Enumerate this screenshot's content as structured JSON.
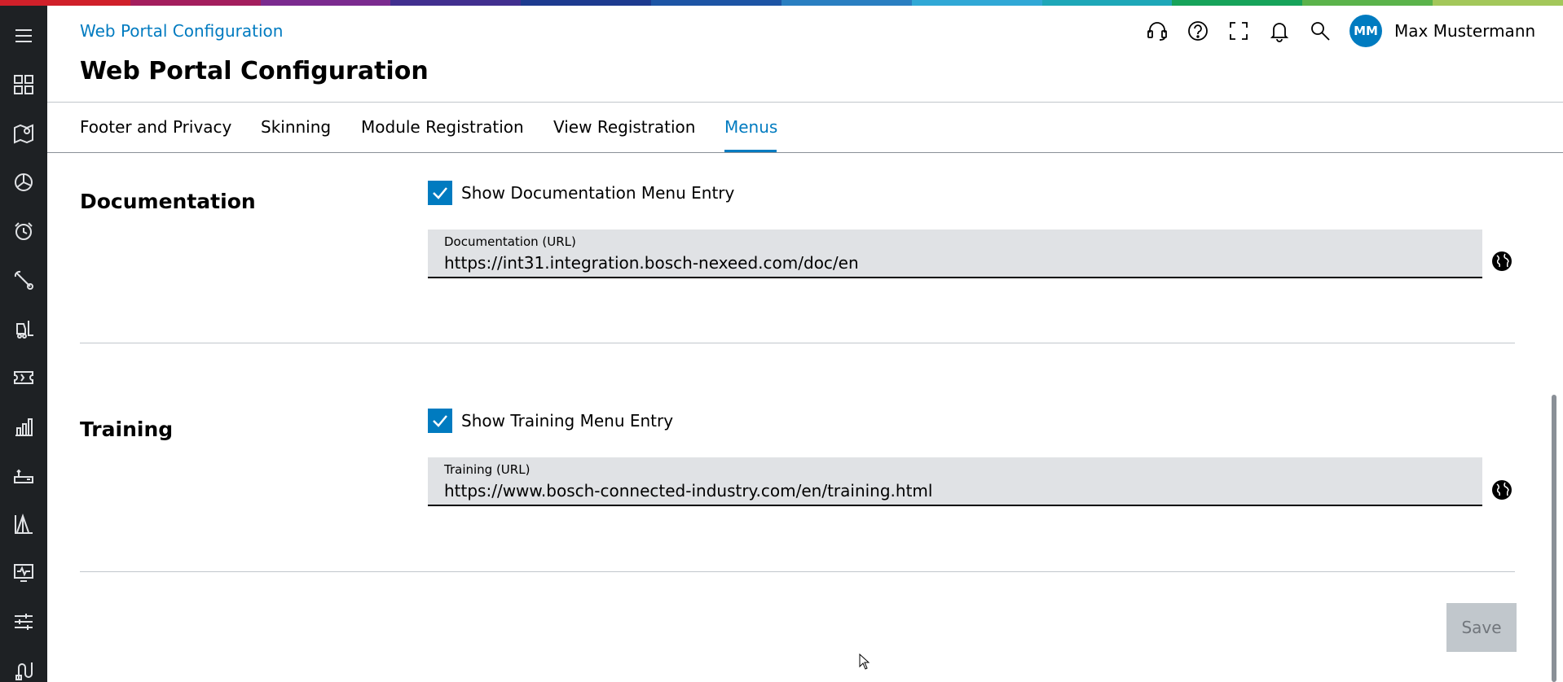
{
  "brand": {
    "colorbar": [
      "#d0202a",
      "#a31e5d",
      "#7b2b8f",
      "#412f8f",
      "#1d3b8f",
      "#1d55a5",
      "#2a7fc1",
      "#30a8d6",
      "#1ea7b8",
      "#17a35a",
      "#5bb34b",
      "#a3c75a"
    ],
    "accent": "#007bc0"
  },
  "sidebar": {
    "items": [
      {
        "icon": "menu-icon"
      },
      {
        "icon": "dashboard-grid-icon"
      },
      {
        "icon": "map-location-icon"
      },
      {
        "icon": "pie-chart-icon"
      },
      {
        "icon": "alarm-clock-icon"
      },
      {
        "icon": "wrench-tool-icon"
      },
      {
        "icon": "forklift-icon"
      },
      {
        "icon": "ticket-icon"
      },
      {
        "icon": "bar-chart-icon"
      },
      {
        "icon": "router-icon"
      },
      {
        "icon": "distribution-chart-icon"
      },
      {
        "icon": "monitor-pulse-icon"
      },
      {
        "icon": "sliders-icon"
      },
      {
        "icon": "plug-cable-icon"
      }
    ]
  },
  "header": {
    "breadcrumb": "Web Portal Configuration",
    "title": "Web Portal Configuration",
    "actions": [
      "headset-icon",
      "help-icon",
      "fullscreen-icon",
      "notification-bell-icon",
      "search-icon"
    ],
    "user": {
      "initials": "MM",
      "name": "Max Mustermann"
    }
  },
  "tabs": {
    "items": [
      {
        "label": "Footer and Privacy",
        "active": false
      },
      {
        "label": "Skinning",
        "active": false
      },
      {
        "label": "Module Registration",
        "active": false
      },
      {
        "label": "View Registration",
        "active": false
      },
      {
        "label": "Menus",
        "active": true
      }
    ]
  },
  "sections": {
    "documentation": {
      "title": "Documentation",
      "checkbox_label": "Show Documentation Menu Entry",
      "checked": true,
      "field_label": "Documentation (URL)",
      "field_value": "https://int31.integration.bosch-nexeed.com/doc/en"
    },
    "training": {
      "title": "Training",
      "checkbox_label": "Show Training Menu Entry",
      "checked": true,
      "field_label": "Training (URL)",
      "field_value": "https://www.bosch-connected-industry.com/en/training.html"
    }
  },
  "footer": {
    "save_label": "Save"
  }
}
